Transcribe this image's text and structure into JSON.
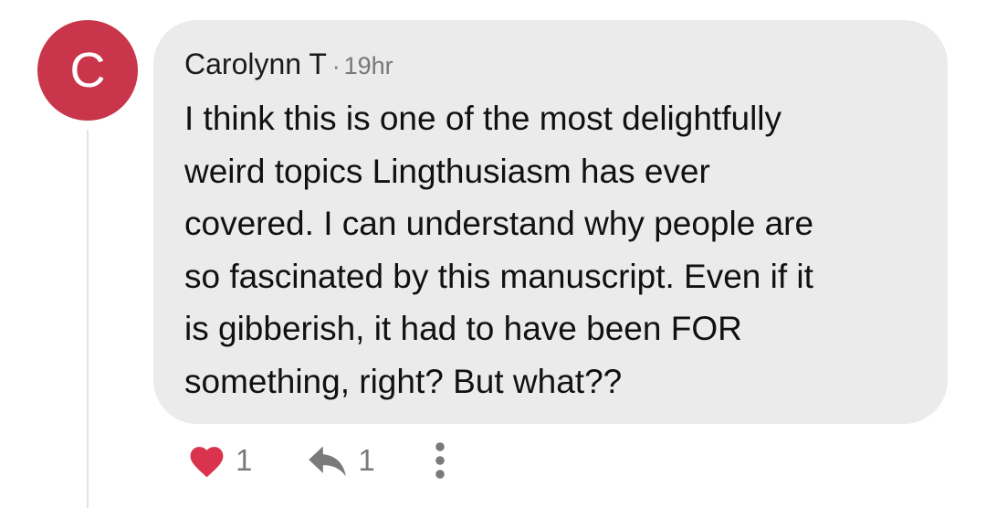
{
  "comment": {
    "avatar_letter": "C",
    "avatar_color": "#c9354a",
    "author": "Carolynn T",
    "separator": "·",
    "time": "19hr",
    "text": "I think this is one of the most  delightfully\nweird topics Lingthusiasm has ever\ncovered. I can understand why people are\nso fascinated by this manuscript. Even if it\nis gibberish, it had to have been FOR\nsomething, right? But what??",
    "bubble_color": "#ebebeb"
  },
  "actions": {
    "like_icon": "heart-icon",
    "like_color": "#d9334d",
    "like_count": "1",
    "reply_icon": "reply-arrow-icon",
    "reply_count": "1",
    "more_icon": "vertical-ellipsis-icon"
  }
}
